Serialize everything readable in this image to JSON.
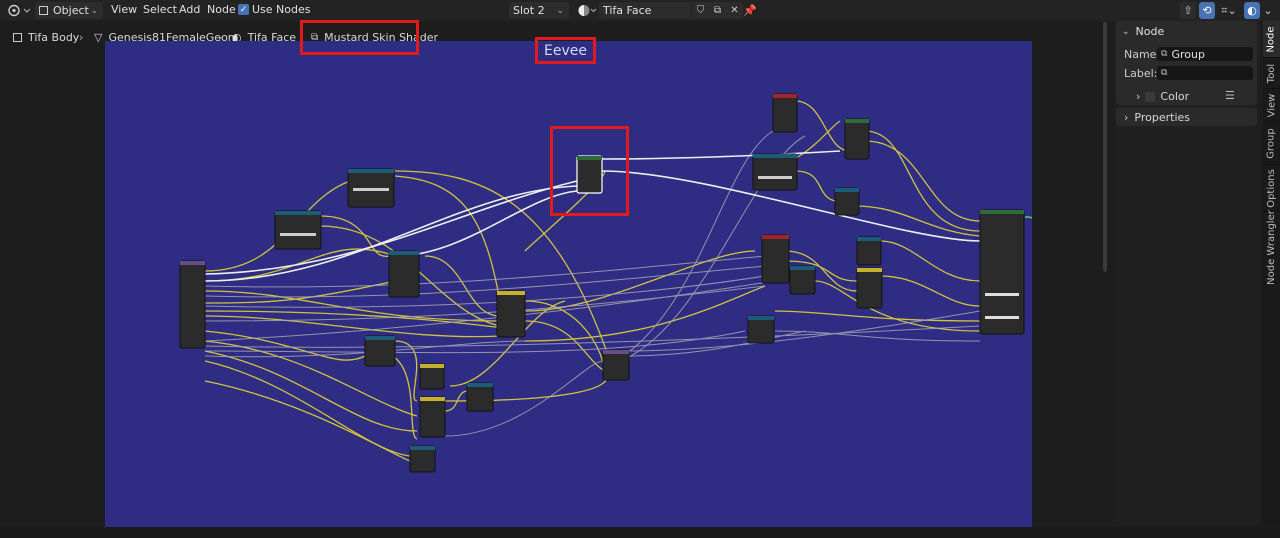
{
  "header": {
    "mode": "Object",
    "menus": [
      "View",
      "Select",
      "Add",
      "Node"
    ],
    "use_nodes_label": "Use Nodes",
    "slot": "Slot 2",
    "material_name": "Tifa Face"
  },
  "breadcrumb": {
    "items": [
      "Tifa Body",
      "Genesis81FemaleGeom",
      "Tifa Face",
      "Mustard Skin Shader"
    ]
  },
  "canvas": {
    "engine_label": "Eevee",
    "background_color": "#2e2d83",
    "highlight_color": "#e01b1b"
  },
  "sidebar": {
    "panel_title": "Node",
    "name_label": "Name:",
    "name_value": "Group",
    "label_label": "Label:",
    "label_value": "",
    "color_label": "Color",
    "properties_label": "Properties"
  },
  "vtabs": [
    "Node",
    "Tool",
    "View",
    "Group",
    "Options",
    "Node Wrangler"
  ]
}
